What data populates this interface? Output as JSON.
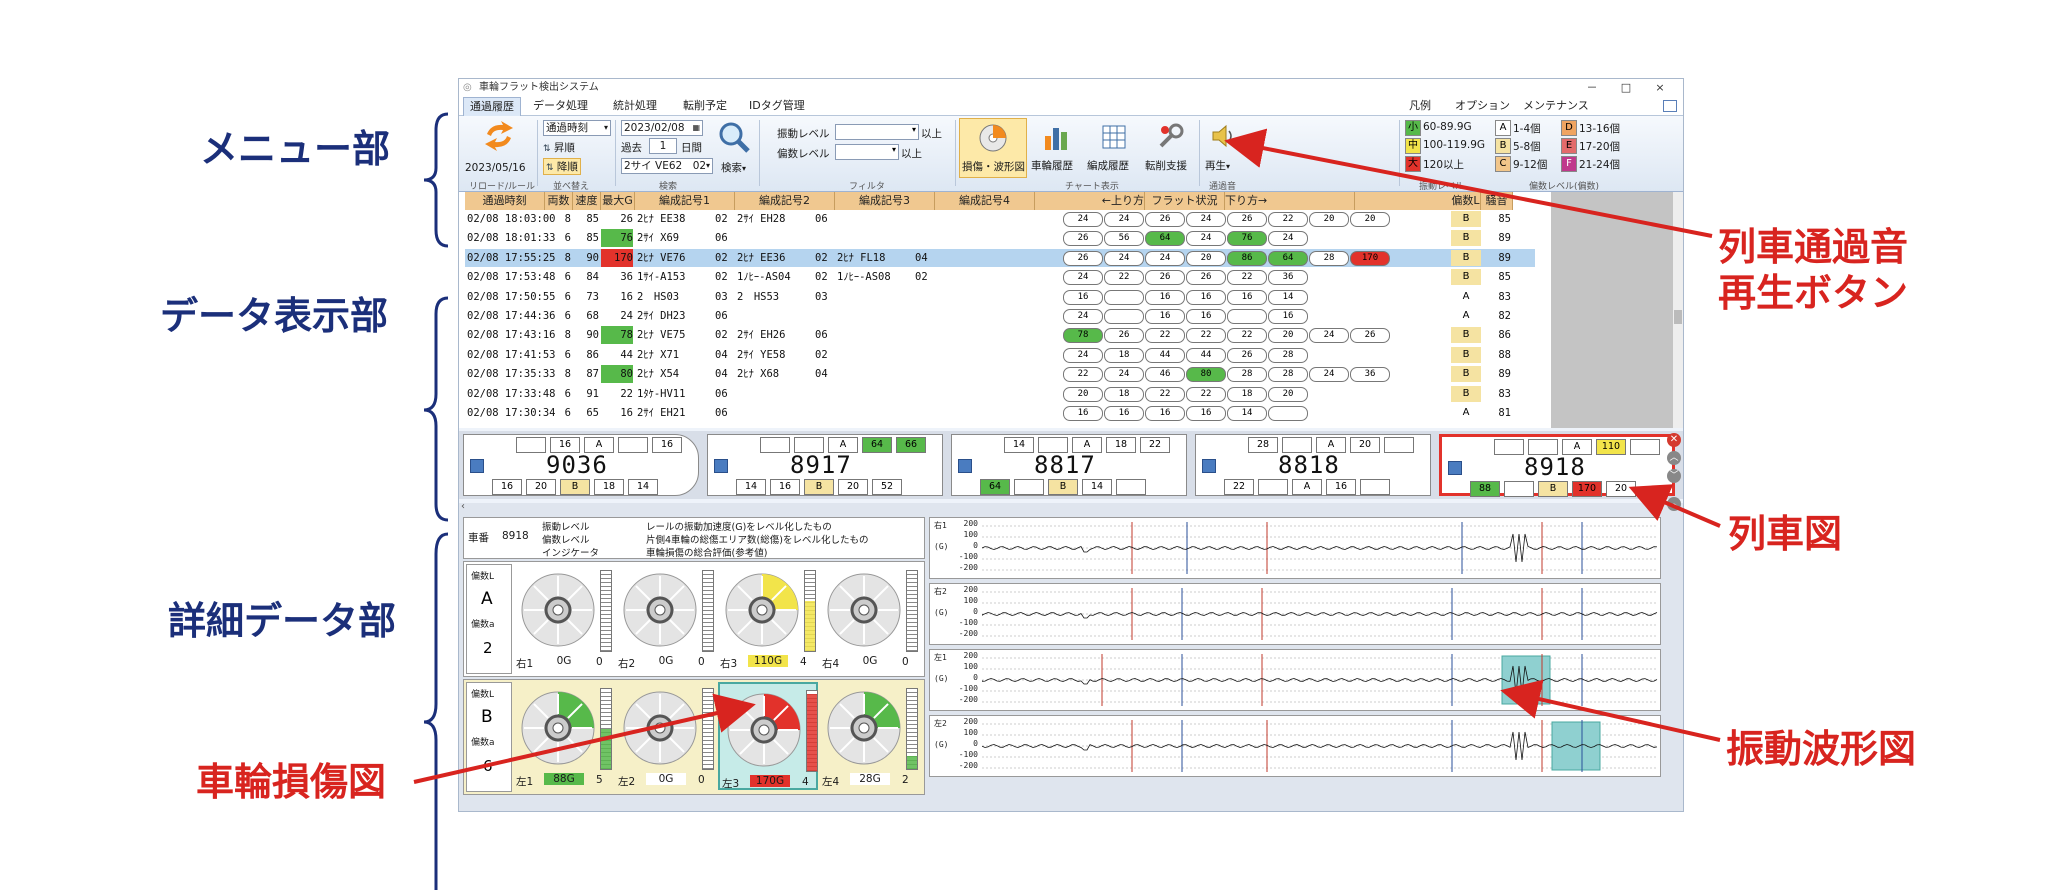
{
  "annotations": {
    "menu": "メニュー部",
    "data_view": "データ表示部",
    "detail": "詳細データ部",
    "train_sound_line1": "列車通過音",
    "train_sound_line2": "再生ボタン",
    "train_diagram": "列車図",
    "wheel_damage": "車輪損傷図",
    "vibration": "振動波形図"
  },
  "window": {
    "title": "車輪フラット検出システム",
    "controls": [
      "－",
      "□",
      "×"
    ]
  },
  "menu_tabs": [
    "通過履歴",
    "データ処理",
    "統計処理",
    "転削予定",
    "IDタグ管理"
  ],
  "menu_tabs_right": [
    "凡例",
    "オプション",
    "メンテナンス"
  ],
  "ribbon": {
    "date_label": "2023/05/16",
    "group_reload": "リロード/ルール",
    "sort_field": "通過時刻",
    "sort_asc": "昇順",
    "sort_desc": "降順",
    "group_sort": "並べ替え",
    "date_value": "2023/02/08",
    "past_label": "過去",
    "days_value": "1",
    "days_unit": "日間",
    "formation_value": "2サイ VE62　02",
    "search_label": "検索",
    "group_search": "検索",
    "vibration_level": "振動レベル",
    "bias_level": "偏数レベル",
    "above1": "以上",
    "above2": "以上",
    "group_filter": "フィルタ",
    "btn_wave": "損傷・波形図",
    "btn_history": "車輪履歴",
    "btn_formation": "編成履歴",
    "btn_rotation": "転削支援",
    "group_chart": "チャート表示",
    "btn_play": "再生",
    "group_sound": "通過音",
    "legend_lv": [
      {
        "mark": "小",
        "text": "60-89.9G",
        "color": "#57b94a"
      },
      {
        "mark": "中",
        "text": "100-119.9G",
        "color": "#f2e44a"
      },
      {
        "mark": "大",
        "text": "120以上",
        "color": "#e2322b"
      }
    ],
    "group_legend_lv": "振動レベル",
    "legend_count": [
      {
        "mark": "A",
        "text": "1-4個",
        "color": "#ffffff"
      },
      {
        "mark": "B",
        "text": "5-8個",
        "color": "#f5e3a2"
      },
      {
        "mark": "C",
        "text": "9-12個",
        "color": "#f2c68a"
      },
      {
        "mark": "D",
        "text": "13-16個",
        "color": "#f0a461"
      },
      {
        "mark": "E",
        "text": "17-20個",
        "color": "#e36b6b"
      },
      {
        "mark": "F",
        "text": "21-24個",
        "color": "#c0398c"
      }
    ],
    "group_legend_count": "偏数レベル(偏数)"
  },
  "table": {
    "headers": [
      "通過時刻",
      "両数",
      "速度",
      "最大G",
      "編成記号1",
      "編成記号2",
      "編成記号3",
      "編成記号4",
      "←上り方",
      "フラット状況",
      "下り方→",
      "偏数L",
      "騒音"
    ],
    "rows": [
      {
        "time": "02/08 18:03:00",
        "cars": "8",
        "speed": "85",
        "maxg": "26",
        "f1": "2ﾋﾅ EE38",
        "f1n": "02",
        "f2": "2ｻｲ EH28",
        "f2n": "06",
        "f3": "",
        "f3n": "",
        "flat": [
          "24",
          "24",
          "26",
          "24",
          "26",
          "22",
          "20",
          "20"
        ],
        "lv": "B",
        "noise": "85"
      },
      {
        "time": "02/08 18:01:33",
        "cars": "6",
        "speed": "85",
        "maxg": "76",
        "f1": "2ｻｲ X69",
        "f1n": "06",
        "f2": "",
        "f2n": "",
        "f3": "",
        "f3n": "",
        "flat": [
          "26",
          "56",
          "64",
          "24",
          "76",
          "24"
        ],
        "lv": "B",
        "noise": "89"
      },
      {
        "time": "02/08 17:55:25",
        "cars": "8",
        "speed": "90",
        "maxg": "170",
        "f1": "2ﾋﾅ VE76",
        "f1n": "02",
        "f2": "2ﾋﾅ EE36",
        "f2n": "02",
        "f3": "2ﾋﾅ FL18",
        "f3n": "04",
        "flat": [
          "26",
          "24",
          "24",
          "20",
          "86",
          "64",
          "28",
          "170"
        ],
        "lv": "B",
        "noise": "89"
      },
      {
        "time": "02/08 17:53:48",
        "cars": "6",
        "speed": "84",
        "maxg": "36",
        "f1": "1ｻｲ-A153",
        "f1n": "02",
        "f2": "1ﾉﾋｰ-AS04",
        "f2n": "02",
        "f3": "1ﾉﾋｰ-AS08",
        "f3n": "02",
        "flat": [
          "24",
          "22",
          "26",
          "26",
          "22",
          "36"
        ],
        "lv": "B",
        "noise": "85"
      },
      {
        "time": "02/08 17:50:55",
        "cars": "6",
        "speed": "73",
        "maxg": "16",
        "f1": "2　HS03",
        "f1n": "03",
        "f2": "2　HS53",
        "f2n": "03",
        "f3": "",
        "f3n": "",
        "flat": [
          "16",
          "",
          "16",
          "16",
          "16",
          "14"
        ],
        "lv": "A",
        "noise": "83"
      },
      {
        "time": "02/08 17:44:36",
        "cars": "6",
        "speed": "68",
        "maxg": "24",
        "f1": "2ｻｲ DH23",
        "f1n": "06",
        "f2": "",
        "f2n": "",
        "f3": "",
        "f3n": "",
        "flat": [
          "24",
          "",
          "16",
          "16",
          "",
          "16"
        ],
        "lv": "A",
        "noise": "82"
      },
      {
        "time": "02/08 17:43:16",
        "cars": "8",
        "speed": "90",
        "maxg": "78",
        "f1": "2ﾋﾅ VE75",
        "f1n": "02",
        "f2": "2ｻｲ EH26",
        "f2n": "06",
        "f3": "",
        "f3n": "",
        "flat": [
          "78",
          "26",
          "22",
          "22",
          "22",
          "20",
          "24",
          "26"
        ],
        "lv": "B",
        "noise": "86"
      },
      {
        "time": "02/08 17:41:53",
        "cars": "6",
        "speed": "86",
        "maxg": "44",
        "f1": "2ﾋﾅ X71",
        "f1n": "04",
        "f2": "2ｻｲ YE58",
        "f2n": "02",
        "f3": "",
        "f3n": "",
        "flat": [
          "24",
          "18",
          "44",
          "44",
          "26",
          "28"
        ],
        "lv": "B",
        "noise": "88"
      },
      {
        "time": "02/08 17:35:33",
        "cars": "8",
        "speed": "87",
        "maxg": "80",
        "f1": "2ﾋﾅ X54",
        "f1n": "04",
        "f2": "2ﾋﾅ X68",
        "f2n": "04",
        "f3": "",
        "f3n": "",
        "flat": [
          "22",
          "24",
          "46",
          "80",
          "28",
          "28",
          "24",
          "36"
        ],
        "lv": "B",
        "noise": "89"
      },
      {
        "time": "02/08 17:33:48",
        "cars": "6",
        "speed": "91",
        "maxg": "22",
        "f1": "1ﾀｹ-HV11",
        "f1n": "06",
        "f2": "",
        "f2n": "",
        "f3": "",
        "f3n": "",
        "flat": [
          "20",
          "18",
          "22",
          "22",
          "18",
          "20"
        ],
        "lv": "B",
        "noise": "83"
      },
      {
        "time": "02/08 17:30:34",
        "cars": "6",
        "speed": "65",
        "maxg": "16",
        "f1": "2ｻｲ EH21",
        "f1n": "06",
        "f2": "",
        "f2n": "",
        "f3": "",
        "f3n": "",
        "flat": [
          "16",
          "16",
          "16",
          "16",
          "14",
          ""
        ],
        "lv": "A",
        "noise": "81"
      }
    ]
  },
  "train_cars": [
    {
      "num": "9036",
      "top": [
        "",
        "16",
        "A",
        "",
        "16"
      ],
      "bottom": [
        "16",
        "20",
        "B",
        "18",
        "14"
      ]
    },
    {
      "num": "8917",
      "top": [
        "",
        "",
        "A",
        "64",
        "66"
      ],
      "bottom": [
        "14",
        "16",
        "B",
        "20",
        "52"
      ]
    },
    {
      "num": "8817",
      "top": [
        "14",
        "",
        "A",
        "18",
        "22"
      ],
      "bottom": [
        "64",
        "",
        "B",
        "14",
        ""
      ]
    },
    {
      "num": "8818",
      "top": [
        "28",
        "",
        "A",
        "20",
        ""
      ],
      "bottom": [
        "22",
        "",
        "A",
        "16",
        ""
      ]
    },
    {
      "num": "8918",
      "top": [
        "",
        "",
        "A",
        "110",
        ""
      ],
      "bottom": [
        "88",
        "",
        "B",
        "170",
        "20"
      ]
    }
  ],
  "detail": {
    "car_label": "車番",
    "car_num": "8918",
    "legend_rows": [
      {
        "k": "振動レベル",
        "v": "レールの振動加速度(G)をレベル化したもの"
      },
      {
        "k": "偏数レベル",
        "v": "片側4車輪の総傷エリア数(総傷)をレベル化したもの"
      },
      {
        "k": "インジケータ",
        "v": "車輪損傷の総合評価(参考値)"
      }
    ],
    "bogies": [
      {
        "side_label": "偏数L",
        "lv": "A",
        "count_label": "偏数a",
        "count": "2",
        "wheels": [
          {
            "name": "右1",
            "g": "0G",
            "n": "0"
          },
          {
            "name": "右2",
            "g": "0G",
            "n": "0"
          },
          {
            "name": "右3",
            "g": "110G",
            "n": "4"
          },
          {
            "name": "右4",
            "g": "0G",
            "n": "0"
          }
        ]
      },
      {
        "side_label": "偏数L",
        "lv": "B",
        "count_label": "偏数a",
        "count": "6",
        "wheels": [
          {
            "name": "左1",
            "g": "88G",
            "n": "5"
          },
          {
            "name": "左2",
            "g": "0G",
            "n": "0"
          },
          {
            "name": "左3",
            "g": "170G",
            "n": "4"
          },
          {
            "name": "左4",
            "g": "28G",
            "n": "2"
          }
        ]
      }
    ],
    "waves": [
      {
        "label": "右1",
        "unit": "(G)",
        "ticks": [
          "200",
          "100",
          "0",
          "-100",
          "-200"
        ]
      },
      {
        "label": "右2",
        "unit": "(G)",
        "ticks": [
          "200",
          "100",
          "0",
          "-100",
          "-200"
        ]
      },
      {
        "label": "左1",
        "unit": "(G)",
        "ticks": [
          "200",
          "100",
          "0",
          "-100",
          "-200"
        ]
      },
      {
        "label": "左2",
        "unit": "(G)",
        "ticks": [
          "200",
          "100",
          "0",
          "-100",
          "-200"
        ]
      }
    ]
  }
}
